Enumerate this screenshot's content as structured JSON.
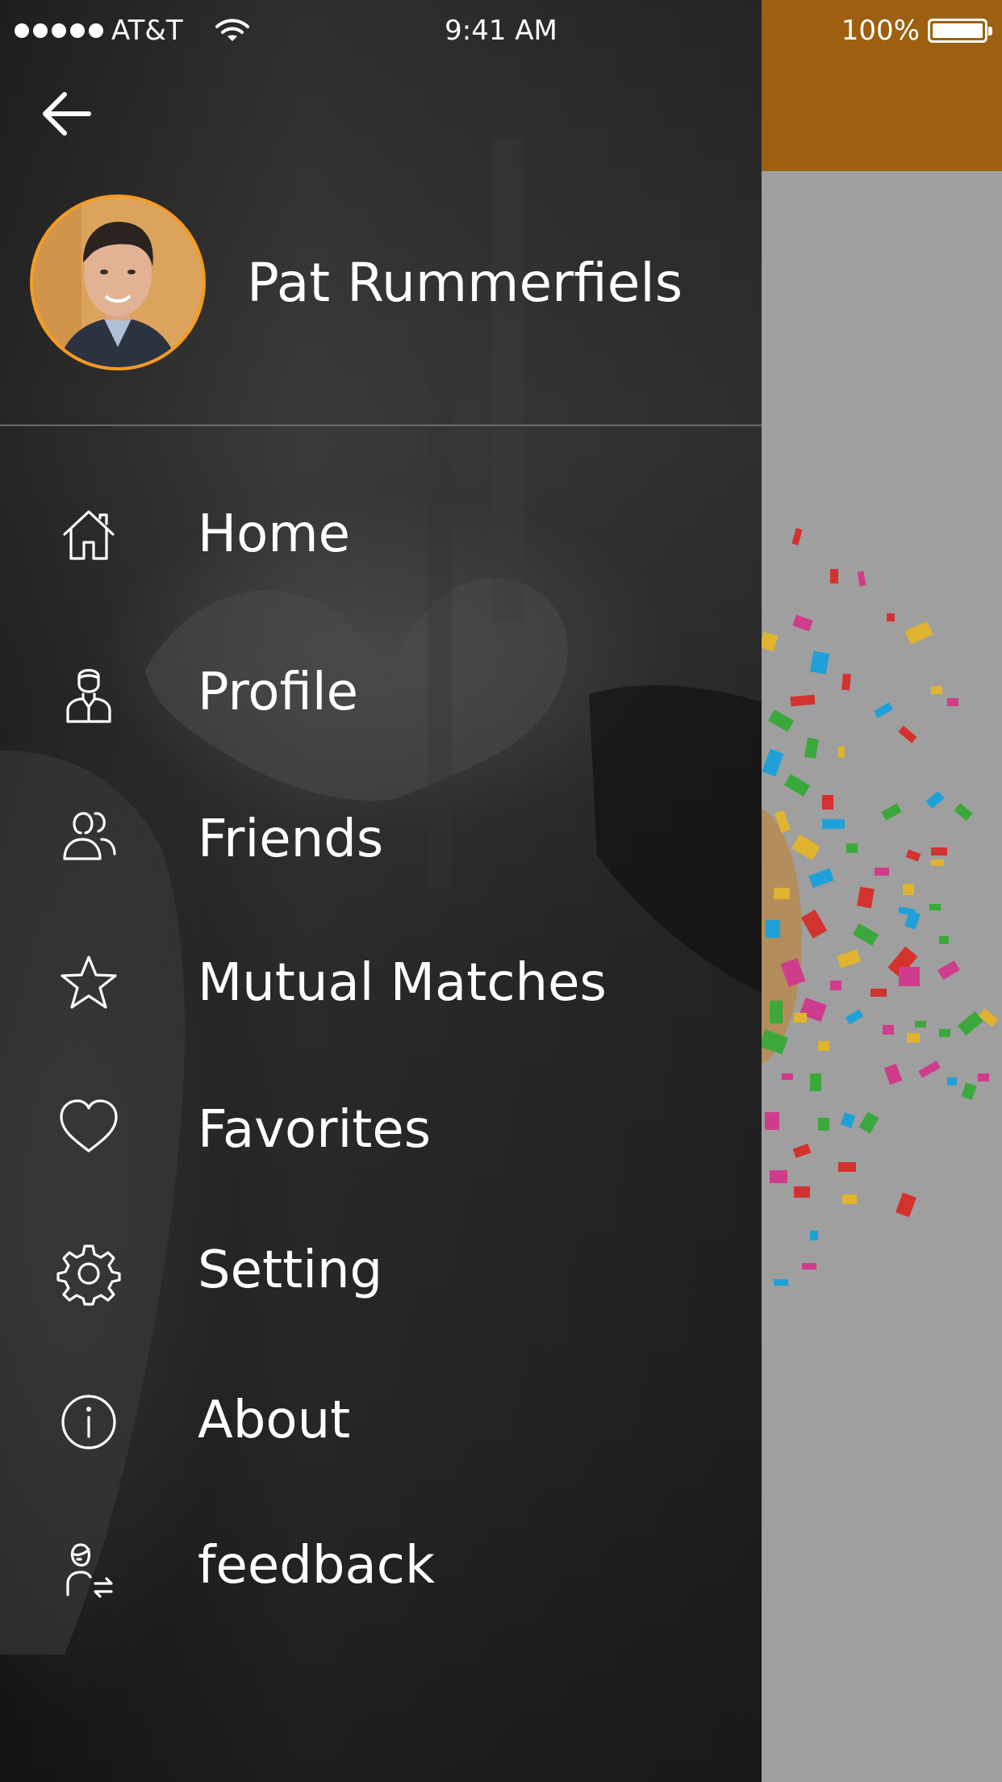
{
  "status_bar": {
    "carrier": "AT&T",
    "time": "9:41 AM",
    "battery": "100%"
  },
  "profile": {
    "name": "Pat Rummerfiels"
  },
  "menu": {
    "items": [
      {
        "label": "Home",
        "icon": "home-icon"
      },
      {
        "label": "Profile",
        "icon": "user-icon"
      },
      {
        "label": "Friends",
        "icon": "friends-icon"
      },
      {
        "label": "Mutual Matches",
        "icon": "star-icon"
      },
      {
        "label": "Favorites",
        "icon": "heart-icon"
      },
      {
        "label": "Setting",
        "icon": "gear-icon"
      },
      {
        "label": "About",
        "icon": "info-icon"
      },
      {
        "label": "feedback",
        "icon": "feedback-icon"
      }
    ]
  },
  "colors": {
    "accent_orange": "#f59a23",
    "header_brown": "#9c6010",
    "drawer_dark": "#2b2b2b",
    "text": "#ffffff"
  }
}
